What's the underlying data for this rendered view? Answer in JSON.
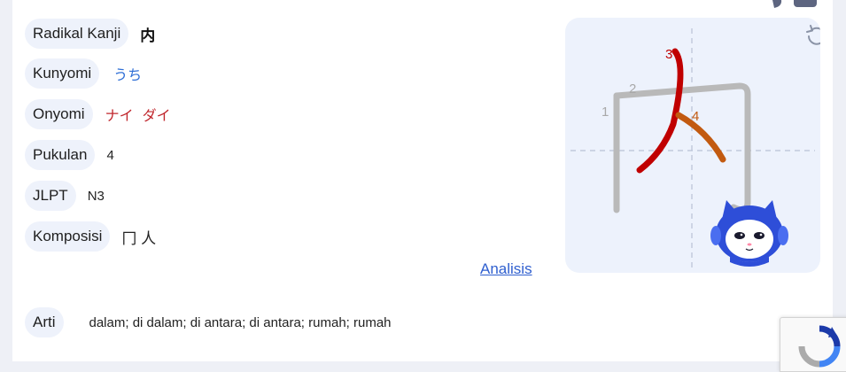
{
  "details": {
    "radical": {
      "label": "Radikal Kanji",
      "value": "内"
    },
    "kunyomi": {
      "label": "Kunyomi",
      "readings": [
        "うち"
      ]
    },
    "onyomi": {
      "label": "Onyomi",
      "readings": [
        "ナイ",
        "ダイ"
      ]
    },
    "strokes": {
      "label": "Pukulan",
      "value": "4"
    },
    "jlpt": {
      "label": "JLPT",
      "value": "N3"
    },
    "composition": {
      "label": "Komposisi",
      "value": "冂 人"
    },
    "meaning": {
      "label": "Arti",
      "value": "dalam; di dalam; di antara; di antara; rumah; rumah"
    }
  },
  "analysis_link": "Analisis",
  "stroke_order": {
    "numbers": [
      "1",
      "2",
      "3",
      "4"
    ],
    "stroke_color_done": "#b9b9b9",
    "stroke_color_active": "#c00000",
    "stroke_color_current": "#c25a10"
  },
  "colors": {
    "pill_bg": "#eef2fb",
    "kunyomi": "#2f6fd6",
    "onyomi": "#c0272d",
    "link": "#2f5fcf"
  }
}
